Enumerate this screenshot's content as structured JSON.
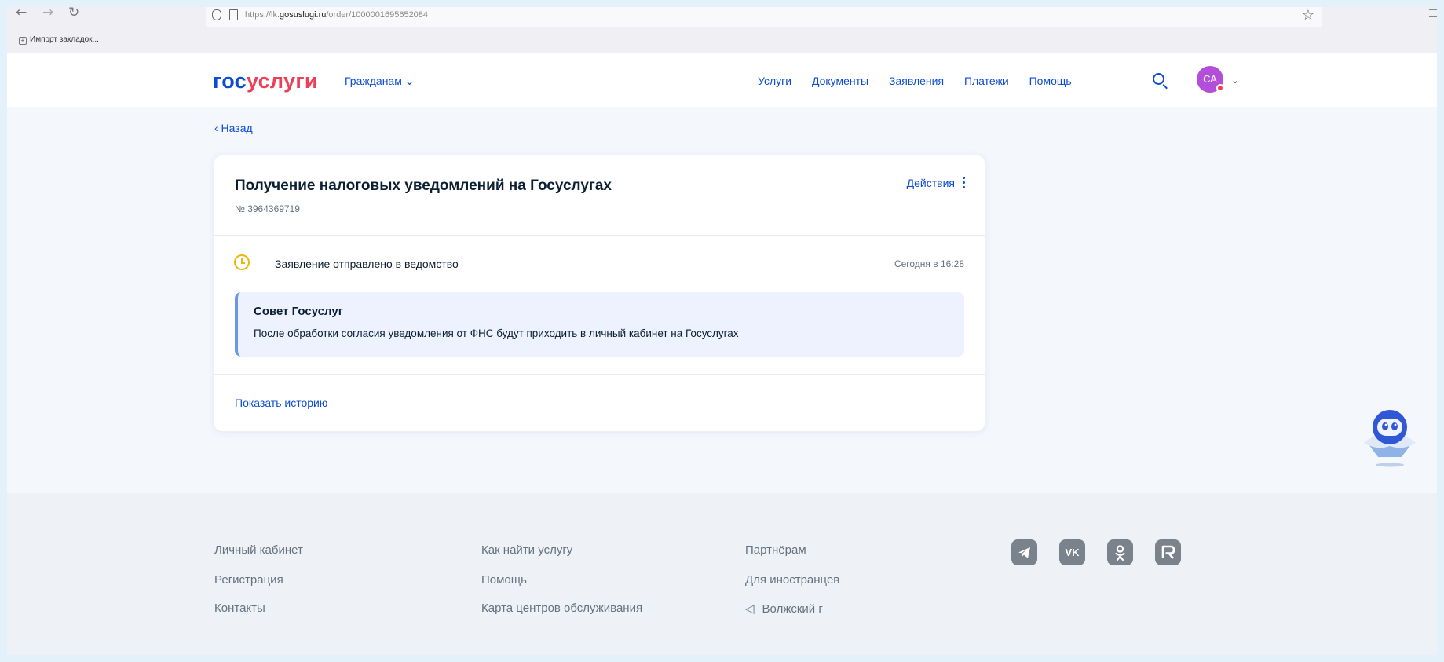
{
  "browser": {
    "back": "←",
    "forward": "→",
    "reload": "↻",
    "url_prefix": "https://lk.",
    "url_domain": "gosuslugi.ru",
    "url_path": "/order/1000001695652084",
    "star": "☆",
    "bookmarks_import": "Импорт закладок..."
  },
  "header": {
    "logo_part1": "гос",
    "logo_part2": "услуги",
    "citizens": "Гражданам",
    "chevron": "⌄",
    "nav": [
      "Услуги",
      "Документы",
      "Заявления",
      "Платежи",
      "Помощь"
    ],
    "avatar_initials": "СА"
  },
  "back": "‹ Назад",
  "order": {
    "title": "Получение налоговых уведомлений на Госуслугах",
    "number": "№ 3964369719",
    "actions_label": "Действия",
    "status": "Заявление отправлено в ведомство",
    "status_time": "Сегодня в 16:28",
    "tip_title": "Совет Госуслуг",
    "tip_text": "После обработки согласия уведомления от ФНС будут приходить в личный кабинет на Госуслугах",
    "show_history": "Показать историю"
  },
  "footer": {
    "col1": [
      "Личный кабинет",
      "Регистрация",
      "Контакты"
    ],
    "col2": [
      "Как найти услугу",
      "Помощь",
      "Карта центров обслуживания"
    ],
    "col3": [
      "Партнёрам",
      "Для иностранцев"
    ],
    "location_arrow": "◁",
    "location": "Волжский г",
    "social": [
      "telegram-icon",
      "vk-icon",
      "odnoklassniki-icon",
      "rutube-icon"
    ]
  },
  "colors": {
    "brand_blue": "#0d4cd3",
    "brand_red": "#ee3f58",
    "status_yellow": "#e9b90a",
    "avatar_purple": "#b34ed8"
  }
}
